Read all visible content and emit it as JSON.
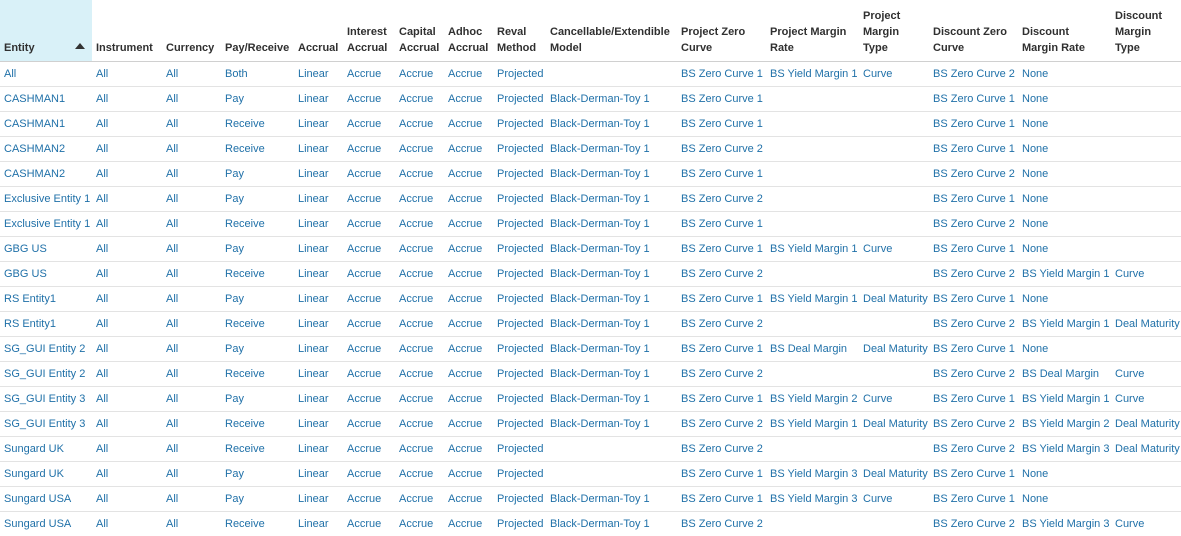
{
  "grid": {
    "sort": {
      "column": "Entity",
      "direction": "ascending"
    },
    "columns": [
      "Entity",
      "Instrument",
      "Currency",
      "Pay/Receive",
      "Accrual",
      "Interest Accrual",
      "Capital Accrual",
      "Adhoc Accrual",
      "Reval Method",
      "Cancellable/Extendible Model",
      "Project Zero Curve",
      "Project Margin Rate",
      "Project Margin Type",
      "Discount Zero Curve",
      "Discount Margin Rate",
      "Discount Margin Type"
    ],
    "rows": [
      [
        "All",
        "All",
        "All",
        "Both",
        "Linear",
        "Accrue",
        "Accrue",
        "Accrue",
        "Projected",
        "",
        "BS Zero Curve 1",
        "BS Yield Margin 1",
        "Curve",
        "BS Zero Curve 2",
        "None",
        ""
      ],
      [
        "CASHMAN1",
        "All",
        "All",
        "Pay",
        "Linear",
        "Accrue",
        "Accrue",
        "Accrue",
        "Projected",
        "Black-Derman-Toy 1",
        "BS Zero Curve 1",
        "",
        "",
        "BS Zero Curve 1",
        "None",
        ""
      ],
      [
        "CASHMAN1",
        "All",
        "All",
        "Receive",
        "Linear",
        "Accrue",
        "Accrue",
        "Accrue",
        "Projected",
        "Black-Derman-Toy 1",
        "BS Zero Curve 1",
        "",
        "",
        "BS Zero Curve 1",
        "None",
        ""
      ],
      [
        "CASHMAN2",
        "All",
        "All",
        "Receive",
        "Linear",
        "Accrue",
        "Accrue",
        "Accrue",
        "Projected",
        "Black-Derman-Toy 1",
        "BS Zero Curve 2",
        "",
        "",
        "BS Zero Curve 1",
        "None",
        ""
      ],
      [
        "CASHMAN2",
        "All",
        "All",
        "Pay",
        "Linear",
        "Accrue",
        "Accrue",
        "Accrue",
        "Projected",
        "Black-Derman-Toy 1",
        "BS Zero Curve 1",
        "",
        "",
        "BS Zero Curve 2",
        "None",
        ""
      ],
      [
        "Exclusive Entity 1",
        "All",
        "All",
        "Pay",
        "Linear",
        "Accrue",
        "Accrue",
        "Accrue",
        "Projected",
        "Black-Derman-Toy 1",
        "BS Zero Curve 2",
        "",
        "",
        "BS Zero Curve 1",
        "None",
        ""
      ],
      [
        "Exclusive Entity 1",
        "All",
        "All",
        "Receive",
        "Linear",
        "Accrue",
        "Accrue",
        "Accrue",
        "Projected",
        "Black-Derman-Toy 1",
        "BS Zero Curve 1",
        "",
        "",
        "BS Zero Curve 2",
        "None",
        ""
      ],
      [
        "GBG US",
        "All",
        "All",
        "Pay",
        "Linear",
        "Accrue",
        "Accrue",
        "Accrue",
        "Projected",
        "Black-Derman-Toy 1",
        "BS Zero Curve 1",
        "BS Yield Margin 1",
        "Curve",
        "BS Zero Curve 1",
        "None",
        ""
      ],
      [
        "GBG US",
        "All",
        "All",
        "Receive",
        "Linear",
        "Accrue",
        "Accrue",
        "Accrue",
        "Projected",
        "Black-Derman-Toy 1",
        "BS Zero Curve 2",
        "",
        "",
        "BS Zero Curve 2",
        "BS Yield Margin 1",
        "Curve"
      ],
      [
        "RS Entity1",
        "All",
        "All",
        "Pay",
        "Linear",
        "Accrue",
        "Accrue",
        "Accrue",
        "Projected",
        "Black-Derman-Toy 1",
        "BS Zero Curve 1",
        "BS Yield Margin 1",
        "Deal Maturity",
        "BS Zero Curve 1",
        "None",
        ""
      ],
      [
        "RS Entity1",
        "All",
        "All",
        "Receive",
        "Linear",
        "Accrue",
        "Accrue",
        "Accrue",
        "Projected",
        "Black-Derman-Toy 1",
        "BS Zero Curve 2",
        "",
        "",
        "BS Zero Curve 2",
        "BS Yield Margin 1",
        "Deal Maturity"
      ],
      [
        "SG_GUI Entity 2",
        "All",
        "All",
        "Pay",
        "Linear",
        "Accrue",
        "Accrue",
        "Accrue",
        "Projected",
        "Black-Derman-Toy 1",
        "BS Zero Curve 1",
        "BS Deal Margin",
        "Deal Maturity",
        "BS Zero Curve 1",
        "None",
        ""
      ],
      [
        "SG_GUI Entity 2",
        "All",
        "All",
        "Receive",
        "Linear",
        "Accrue",
        "Accrue",
        "Accrue",
        "Projected",
        "Black-Derman-Toy 1",
        "BS Zero Curve 2",
        "",
        "",
        "BS Zero Curve 2",
        "BS Deal Margin",
        "Curve"
      ],
      [
        "SG_GUI Entity 3",
        "All",
        "All",
        "Pay",
        "Linear",
        "Accrue",
        "Accrue",
        "Accrue",
        "Projected",
        "Black-Derman-Toy 1",
        "BS Zero Curve 1",
        "BS Yield Margin 2",
        "Curve",
        "BS Zero Curve 1",
        "BS Yield Margin 1",
        "Curve"
      ],
      [
        "SG_GUI Entity 3",
        "All",
        "All",
        "Receive",
        "Linear",
        "Accrue",
        "Accrue",
        "Accrue",
        "Projected",
        "Black-Derman-Toy 1",
        "BS Zero Curve 2",
        "BS Yield Margin 1",
        "Deal Maturity",
        "BS Zero Curve 2",
        "BS Yield Margin 2",
        "Deal Maturity"
      ],
      [
        "Sungard UK",
        "All",
        "All",
        "Receive",
        "Linear",
        "Accrue",
        "Accrue",
        "Accrue",
        "Projected",
        "",
        "BS Zero Curve 2",
        "",
        "",
        "BS Zero Curve 2",
        "BS Yield Margin 3",
        "Deal Maturity"
      ],
      [
        "Sungard UK",
        "All",
        "All",
        "Pay",
        "Linear",
        "Accrue",
        "Accrue",
        "Accrue",
        "Projected",
        "",
        "BS Zero Curve 1",
        "BS Yield Margin 3",
        "Deal Maturity",
        "BS Zero Curve 1",
        "None",
        ""
      ],
      [
        "Sungard USA",
        "All",
        "All",
        "Pay",
        "Linear",
        "Accrue",
        "Accrue",
        "Accrue",
        "Projected",
        "Black-Derman-Toy 1",
        "BS Zero Curve 1",
        "BS Yield Margin 3",
        "Curve",
        "BS Zero Curve 1",
        "None",
        ""
      ],
      [
        "Sungard USA",
        "All",
        "All",
        "Receive",
        "Linear",
        "Accrue",
        "Accrue",
        "Accrue",
        "Projected",
        "Black-Derman-Toy 1",
        "BS Zero Curve 2",
        "",
        "",
        "BS Zero Curve 2",
        "BS Yield Margin 3",
        "Curve"
      ]
    ]
  }
}
